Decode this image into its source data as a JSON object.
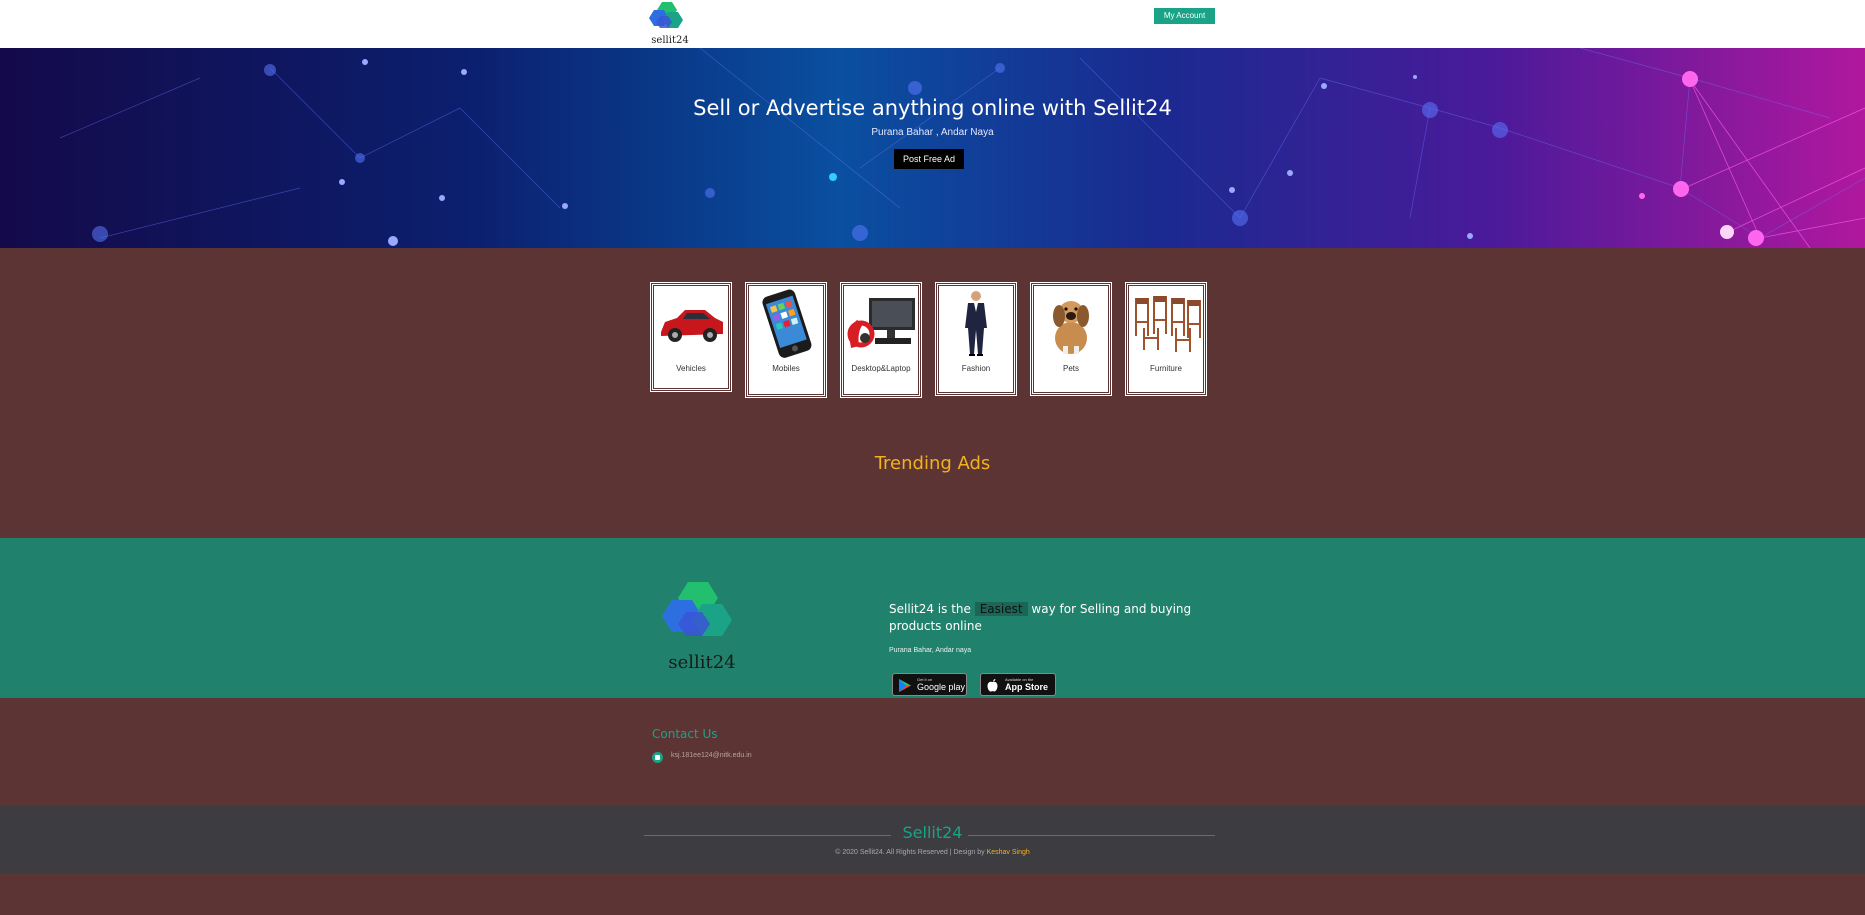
{
  "header": {
    "logo_text": "sellit24",
    "account_button": "My Account"
  },
  "hero": {
    "title": "Sell or Advertise anything online with Sellit24",
    "subtitle": "Purana Bahar , Andar Naya",
    "post_button": "Post Free Ad"
  },
  "categories": [
    {
      "label": "Vehicles",
      "icon": "car-image"
    },
    {
      "label": "Mobiles",
      "icon": "phone-image"
    },
    {
      "label": "Desktop&Laptop",
      "icon": "desktop-image"
    },
    {
      "label": "Fashion",
      "icon": "suit-image"
    },
    {
      "label": "Pets",
      "icon": "dog-image"
    },
    {
      "label": "Furniture",
      "icon": "chairs-image"
    }
  ],
  "trending": {
    "title": "Trending Ads"
  },
  "band": {
    "logo_text": "sellit24",
    "tagline_before": "Sellit24 is the",
    "tagline_highlight": "Easiest",
    "tagline_after": "way for Selling and buying products online",
    "address": "Purana Bahar, Andar naya",
    "google_play": {
      "small": "Get it on",
      "big": "Google play"
    },
    "app_store": {
      "small": "Available on the",
      "big": "App Store"
    }
  },
  "contact": {
    "title": "Contact Us",
    "email": "ksj.181ee124@nitk.edu.in"
  },
  "footer": {
    "brand": "Sellit24",
    "copyright": "© 2020 Sellit24. All Rights Reserved | Design by",
    "author": "Keshav Singh"
  },
  "colors": {
    "accent": "#1aa386",
    "brown": "#5c3434",
    "gold": "#f2b21c",
    "band": "#20826c",
    "footer": "#3d3c40"
  }
}
